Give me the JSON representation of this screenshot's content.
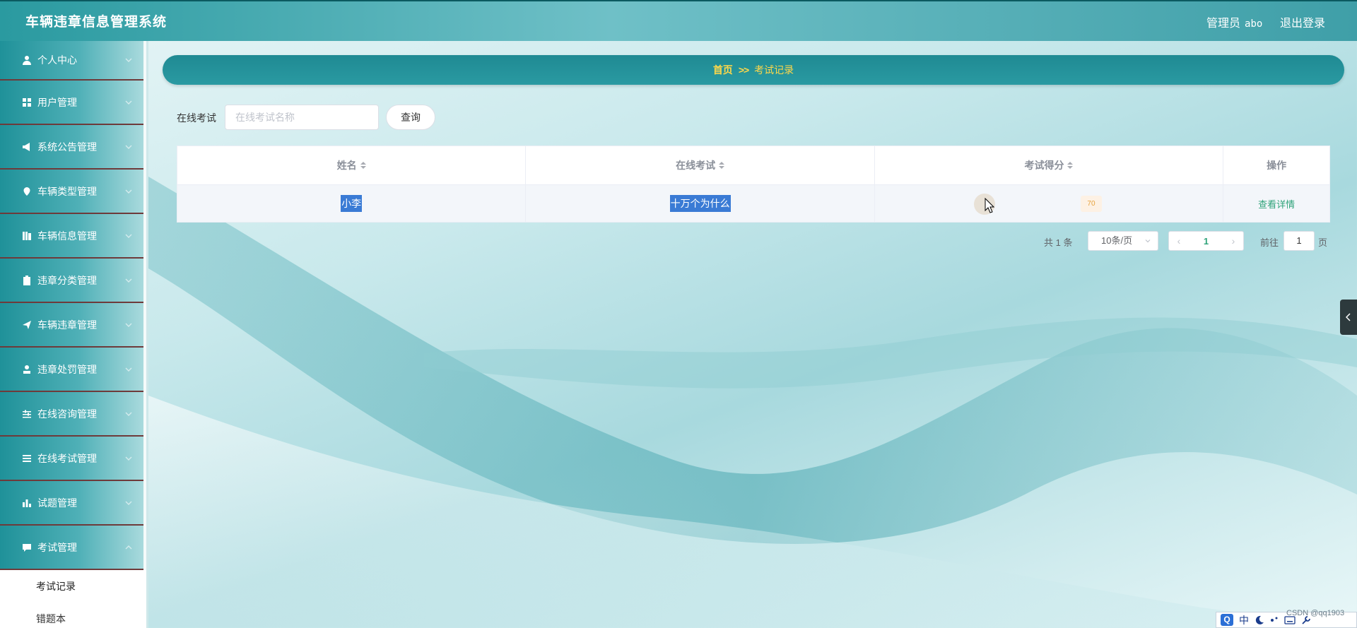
{
  "app": {
    "title": "车辆违章信息管理系统",
    "user_label": "管理员",
    "username": "abo",
    "logout_label": "退出登录"
  },
  "sidebar": {
    "items": [
      {
        "label": "个人中心",
        "icon": "user-icon"
      },
      {
        "label": "用户管理",
        "icon": "grid-icon"
      },
      {
        "label": "系统公告管理",
        "icon": "megaphone-icon"
      },
      {
        "label": "车辆类型管理",
        "icon": "pin-icon"
      },
      {
        "label": "车辆信息管理",
        "icon": "list-icon"
      },
      {
        "label": "违章分类管理",
        "icon": "clipboard-icon"
      },
      {
        "label": "车辆违章管理",
        "icon": "send-icon"
      },
      {
        "label": "违章处罚管理",
        "icon": "person-icon"
      },
      {
        "label": "在线咨询管理",
        "icon": "sliders-icon"
      },
      {
        "label": "在线考试管理",
        "icon": "menu-icon"
      },
      {
        "label": "试题管理",
        "icon": "bar-chart-icon"
      },
      {
        "label": "考试管理",
        "icon": "comment-icon"
      }
    ],
    "submenu": [
      {
        "label": "考试记录",
        "active": true
      },
      {
        "label": "错题本",
        "active": false
      }
    ]
  },
  "breadcrumb": {
    "home": "首页",
    "separator": ">>",
    "current": "考试记录"
  },
  "search": {
    "label": "在线考试",
    "placeholder": "在线考试名称",
    "value": "",
    "button_label": "查询"
  },
  "table": {
    "columns": [
      "姓名",
      "在线考试",
      "考试得分",
      "操作"
    ],
    "rows": [
      {
        "name": "小李",
        "exam": "十万个为什么",
        "score": "70",
        "action": "查看详情"
      }
    ]
  },
  "pagination": {
    "total_text": "共 1 条",
    "page_size": "10条/页",
    "current_page": "1",
    "goto_label": "前往",
    "goto_value": "1",
    "page_label": "页"
  },
  "ime": {
    "badge": "Q",
    "mode": "中"
  },
  "watermark": "CSDN @qq1903",
  "colors": {
    "header": "#2a9aa0",
    "breadcrumb": "#1f8a93",
    "breadcrumb_text": "#ffd84a",
    "link": "#2fa37a",
    "score_badge": "#e6a23c"
  }
}
